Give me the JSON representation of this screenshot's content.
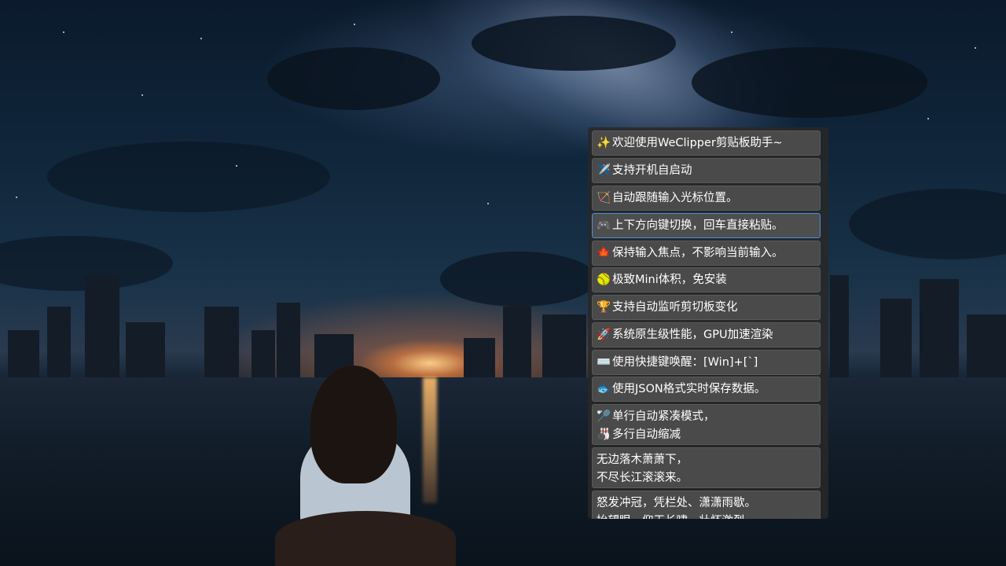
{
  "clipboard": {
    "items": [
      {
        "lines": [
          {
            "emoji": "✨",
            "text": "欢迎使用WeClipper剪贴板助手~"
          }
        ]
      },
      {
        "lines": [
          {
            "emoji": "✈️",
            "text": "支持开机自启动"
          }
        ]
      },
      {
        "lines": [
          {
            "emoji": "🏹",
            "text": "自动跟随输入光标位置。"
          }
        ]
      },
      {
        "lines": [
          {
            "emoji": "🎮",
            "text": "上下方向键切换，回车直接粘贴。"
          }
        ],
        "selected": true
      },
      {
        "lines": [
          {
            "emoji": "🍁",
            "text": "保持输入焦点，不影响当前输入。"
          }
        ]
      },
      {
        "lines": [
          {
            "emoji": "🥎",
            "text": "极致Mini体积，免安装"
          }
        ]
      },
      {
        "lines": [
          {
            "emoji": "🏆",
            "text": "支持自动监听剪切板变化"
          }
        ]
      },
      {
        "lines": [
          {
            "emoji": "🚀",
            "text": "系统原生级性能，GPU加速渲染"
          }
        ]
      },
      {
        "lines": [
          {
            "emoji": "⌨️",
            "text": "使用快捷键唤醒：[Win]+[`]"
          }
        ]
      },
      {
        "lines": [
          {
            "emoji": "🐟",
            "text": "使用JSON格式实时保存数据。"
          }
        ]
      },
      {
        "lines": [
          {
            "emoji": "🏸",
            "text": "单行自动紧凑模式，"
          },
          {
            "emoji": "🎳",
            "text": "多行自动缩减"
          }
        ]
      },
      {
        "lines": [
          {
            "emoji": "",
            "text": "无边落木萧萧下，"
          },
          {
            "emoji": "",
            "text": "不尽长江滚滚来。"
          }
        ]
      },
      {
        "lines": [
          {
            "emoji": "",
            "text": "怒发冲冠，凭栏处、潇潇雨歇。"
          },
          {
            "emoji": "",
            "text": "抬望眼，仰天长啸，壮怀激烈。"
          }
        ]
      }
    ]
  },
  "colors": {
    "panel_bg": "#282828",
    "item_bg": "#4a4a4a",
    "selected_border": "#4a90e2",
    "text": "#ffffff"
  }
}
